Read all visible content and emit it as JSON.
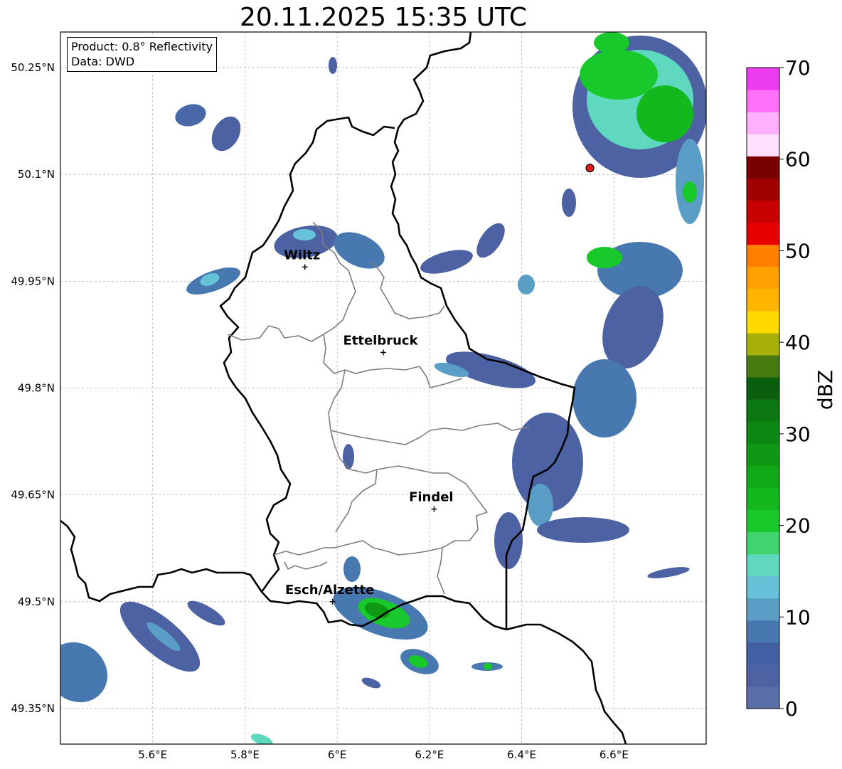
{
  "title": "20.11.2025 15:35 UTC",
  "info": {
    "product": "Product: 0.8° Reflectivity",
    "data": "Data: DWD"
  },
  "map": {
    "lon_range": [
      5.4,
      6.8
    ],
    "lat_range": [
      49.3,
      50.3
    ],
    "lat_ticks": [
      {
        "value": 50.25,
        "label": "50.25°N"
      },
      {
        "value": 50.1,
        "label": "50.1°N"
      },
      {
        "value": 49.95,
        "label": "49.95°N"
      },
      {
        "value": 49.8,
        "label": "49.8°N"
      },
      {
        "value": 49.65,
        "label": "49.65°N"
      },
      {
        "value": 49.5,
        "label": "49.5°N"
      },
      {
        "value": 49.35,
        "label": "49.35°N"
      }
    ],
    "lon_ticks": [
      {
        "value": 5.6,
        "label": "5.6°E"
      },
      {
        "value": 5.8,
        "label": "5.8°E"
      },
      {
        "value": 6.0,
        "label": "6°E"
      },
      {
        "value": 6.2,
        "label": "6.2°E"
      },
      {
        "value": 6.4,
        "label": "6.4°E"
      },
      {
        "value": 6.6,
        "label": "6.6°E"
      }
    ],
    "grid": true,
    "cities": [
      {
        "name": "Wiltz",
        "lon": 5.93,
        "lat": 49.97
      },
      {
        "name": "Ettelbruck",
        "lon": 6.1,
        "lat": 49.85
      },
      {
        "name": "Findel",
        "lon": 6.21,
        "lat": 49.63
      },
      {
        "name": "Esch/Alzette",
        "lon": 5.99,
        "lat": 49.5
      }
    ],
    "radar_site": {
      "lon": 6.548,
      "lat": 50.109,
      "color": "#e41a1c"
    }
  },
  "colorbar": {
    "label": "dBZ",
    "ticks": [
      0,
      10,
      20,
      30,
      40,
      50,
      60,
      70
    ],
    "min": 0,
    "max": 70,
    "colors": [
      "#5a6ea8",
      "#4d62a3",
      "#4460a5",
      "#4878b0",
      "#5a9ec6",
      "#66c2d9",
      "#5fd8c0",
      "#3fd46e",
      "#19c82b",
      "#13b91c",
      "#11a818",
      "#0f9814",
      "#0c8812",
      "#0b7811",
      "#0a5e0e",
      "#477a10",
      "#a8b108",
      "#ffd800",
      "#ffb500",
      "#ffa000",
      "#ff8000",
      "#e80000",
      "#c80000",
      "#a00000",
      "#7a0000",
      "#ffe0ff",
      "#ffb0ff",
      "#ff70f8",
      "#ec3cf0"
    ]
  }
}
